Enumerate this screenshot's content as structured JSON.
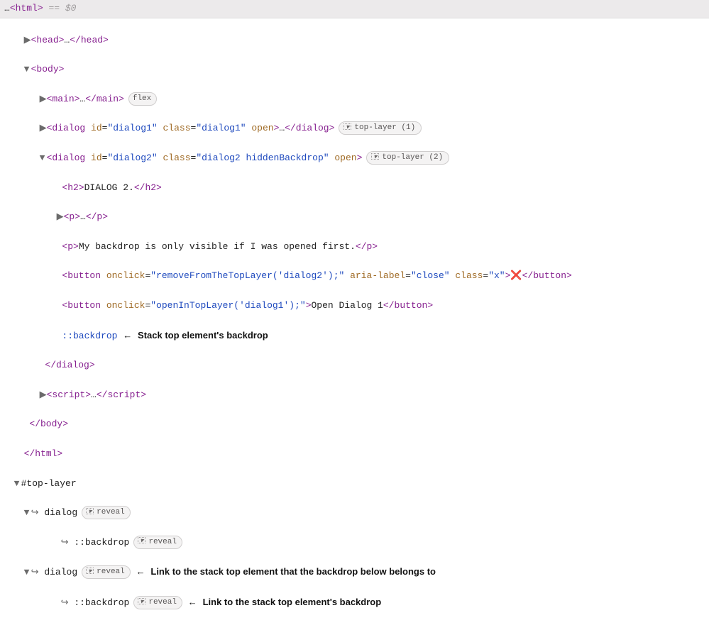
{
  "topbar": {
    "prefix": "…",
    "selected_expr": "== $0"
  },
  "tags": {
    "html_open": "<html>",
    "html_close": "</html>",
    "head_open": "<head>",
    "head_close": "</head>",
    "body_open": "<body>",
    "body_close": "</body>",
    "main_open": "<main>",
    "main_close": "</main>",
    "script_open": "<script>",
    "script_close": "</script>",
    "dialog_close": "</dialog>",
    "h2_open": "<h2>",
    "h2_close": "</h2>",
    "p_open": "<p>",
    "p_close": "</p>",
    "button_open": "<button",
    "button_close": "</button>",
    "dialog_open": "<dialog"
  },
  "attrs": {
    "id": "id",
    "class": "class",
    "open": "open",
    "onclick": "onclick",
    "aria_label": "aria-label"
  },
  "dialog1": {
    "id": "\"dialog1\"",
    "class": "\"dialog1\""
  },
  "dialog2": {
    "id": "\"dialog2\"",
    "class": "\"dialog2 hiddenBackdrop\"",
    "h2_text": "DIALOG 2.",
    "p_text": "My backdrop is only visible if I was opened first.",
    "btn_x_onclick": "\"removeFromTheTopLayer('dialog2');\"",
    "btn_x_aria": "\"close\"",
    "btn_x_class": "\"x\"",
    "btn_x_text": "❌",
    "btn_open_onclick": "\"openInTopLayer('dialog1');\"",
    "btn_open_text": "Open Dialog 1"
  },
  "pseudo": {
    "backdrop": "::backdrop"
  },
  "annotations": {
    "backdrop_inline": "Stack top element's backdrop",
    "link_dialog": "Link to the stack top element that the backdrop below belongs to",
    "link_backdrop": "Link to the stack top element's backdrop"
  },
  "badges": {
    "flex": "flex",
    "top_layer_1": "top-layer (1)",
    "top_layer_2": "top-layer (2)",
    "reveal": "reveal"
  },
  "toplayer": {
    "header": "#top-layer",
    "dialog": "dialog",
    "backdrop": "::backdrop"
  },
  "glyphs": {
    "ellipsis": "…",
    "tri_right": "▶",
    "tri_down": "▼",
    "hook_arrow": "↪",
    "left_arrow": "←"
  }
}
